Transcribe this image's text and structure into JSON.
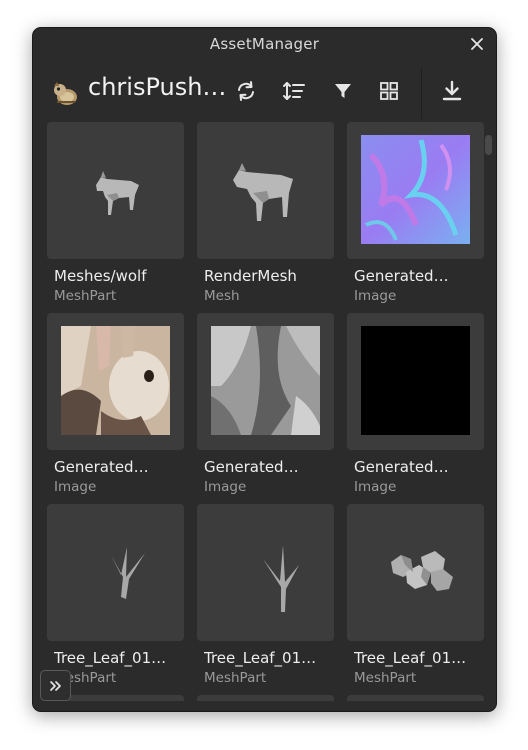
{
  "window": {
    "title": "AssetManager"
  },
  "toolbar": {
    "user_name": "chrisPush…"
  },
  "icons": {
    "close": "close-icon",
    "avatar": "avatar-icon",
    "refresh": "refresh-icon",
    "sort": "sort-icon",
    "filter": "filter-icon",
    "grid": "grid-view-icon",
    "download": "download-icon",
    "expand": "double-chevron-right-icon"
  },
  "assets": [
    {
      "name": "Meshes/wolf",
      "type": "MeshPart"
    },
    {
      "name": "RenderMesh",
      "type": "Mesh"
    },
    {
      "name": "Generated…",
      "type": "Image"
    },
    {
      "name": "Generated…",
      "type": "Image"
    },
    {
      "name": "Generated…",
      "type": "Image"
    },
    {
      "name": "Generated…",
      "type": "Image"
    },
    {
      "name": "Tree_Leaf_01…",
      "type": "MeshPart"
    },
    {
      "name": "Tree_Leaf_01…",
      "type": "MeshPart"
    },
    {
      "name": "Tree_Leaf_01…",
      "type": "MeshPart"
    }
  ],
  "colors": {
    "background": "#2b2b2b",
    "tile": "#3c3c3c",
    "text_primary": "#eeeeee",
    "text_secondary": "#9a9a9a"
  }
}
